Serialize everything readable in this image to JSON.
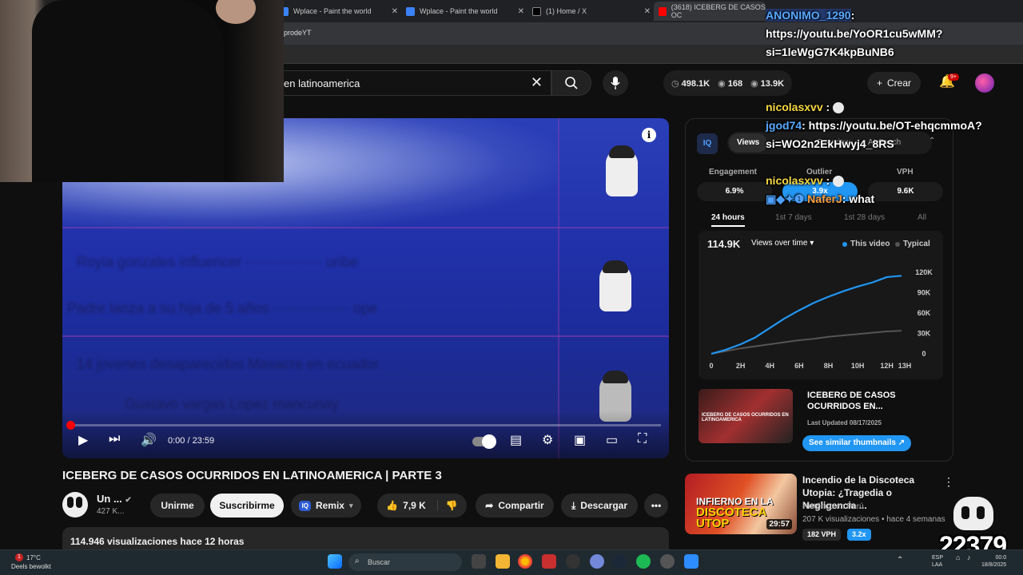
{
  "browser": {
    "tabs": [
      {
        "label": "Wplace - Paint the world"
      },
      {
        "label": "Wplace - Paint the world"
      },
      {
        "label": "(1) Home / X"
      },
      {
        "label": "(3618) ICEBERG DE CASOS OC"
      }
    ],
    "profile_text": "prodeYT",
    "colors": {
      "youtube_red": "#ff0000",
      "chrome_bg": "#202124"
    }
  },
  "youtube_header": {
    "search_value": "en latinoamerica",
    "stats": {
      "views": "498.1K",
      "viewers": "168",
      "third": "13.9K"
    },
    "create_label": "Crear",
    "notifications_badge": "9+"
  },
  "player": {
    "time": "0:00 / 23:59",
    "info_icon": "i",
    "progress_fraction": 0.0
  },
  "video": {
    "title": "ICEBERG DE CASOS OCURRIDOS EN LATINOAMERICA | PARTE 3",
    "channel_name": "Un ...",
    "channel_subs": "427 K...",
    "join_label": "Unirme",
    "subscribe_label": "Suscribirme",
    "remix_label": "Remix",
    "likes": "7,9 K",
    "share_label": "Compartir",
    "download_label": "Descargar",
    "views_line": "114.946 visualizaciones  hace 12 horas"
  },
  "vidiq": {
    "logo": "IQ",
    "tabs": [
      "Views",
      "Overview",
      "AI Coach"
    ],
    "metrics": [
      {
        "label": "Engagement",
        "value": "6.9%"
      },
      {
        "label": "Outlier",
        "value": "3.9x"
      },
      {
        "label": "VPH",
        "value": "9.6K"
      }
    ],
    "ranges": [
      "24 hours",
      "1st 7 days",
      "1st 28 days",
      "All"
    ],
    "chart_total": "114.9K",
    "chart_selector": "Views over time",
    "legend_this": "This video",
    "legend_typical": "Typical",
    "card_title_1": "ICEBERG DE CASOS",
    "card_title_2": "OCURRIDOS EN...",
    "card_updated": "Last Updated 08/17/2025",
    "card_button": "See similar thumbnails"
  },
  "chart_data": {
    "type": "line",
    "title": "",
    "xlabel": "",
    "ylabel": "",
    "categories": [
      "0",
      "2H",
      "4H",
      "6H",
      "8H",
      "10H",
      "12H",
      "13H"
    ],
    "x": [
      0,
      1,
      2,
      3,
      4,
      5,
      6,
      7,
      8,
      9,
      10,
      11,
      12,
      13
    ],
    "series": [
      {
        "name": "This video",
        "values": [
          0,
          6000,
          14000,
          24000,
          38000,
          52000,
          64000,
          75000,
          84000,
          92000,
          99000,
          105000,
          113000,
          114900
        ]
      },
      {
        "name": "Typical",
        "values": [
          0,
          4000,
          8000,
          11000,
          14000,
          17000,
          20000,
          22000,
          25000,
          27000,
          29000,
          31000,
          33000,
          34000
        ]
      }
    ],
    "yticks": [
      "0",
      "30K",
      "60K",
      "90K",
      "120K"
    ],
    "ylim": [
      0,
      120000
    ],
    "grid": false,
    "legend": "top-right",
    "colors": {
      "this_video": "#2196f3",
      "typical": "#555555"
    }
  },
  "recommended": {
    "title": "Incendio de la Discoteca Utopia: ¿Tragedia o Negligencia ...",
    "channel": "Histórico en Perú",
    "meta": "207 K visualizaciones  •  hace 4 semanas",
    "duration": "29:57",
    "badge_vph": "182 VPH",
    "badge_outlier": "3.2x",
    "thumb_line1": "INFIERNO EN LA",
    "thumb_line2": "DISCOTECA UTOP"
  },
  "chat": [
    {
      "user": "ANONIMO_1290",
      "text": ": https://youtu.be/YoOR1cu5wMM?si=1leWgG7K4kpBuNB6"
    },
    {
      "user": "nicolasxvv",
      "text": ":"
    },
    {
      "user": "jgod74",
      "text": ": https://youtu.be/OT-ehqcmmoA?si=WO2n2EkHwyj4_8RS"
    },
    {
      "user": "nicolasxvv",
      "text": ":"
    },
    {
      "user": "NaferJ",
      "text": ": what"
    }
  ],
  "overlay_counter": "22379",
  "taskbar": {
    "weather_temp": "17°C",
    "weather_desc": "Deels bewolkt",
    "weather_badge": "1",
    "search_label": "Buscar",
    "lang": "ESP",
    "lang2": "LAA",
    "time": "00:0",
    "date": "18/8/2025"
  }
}
